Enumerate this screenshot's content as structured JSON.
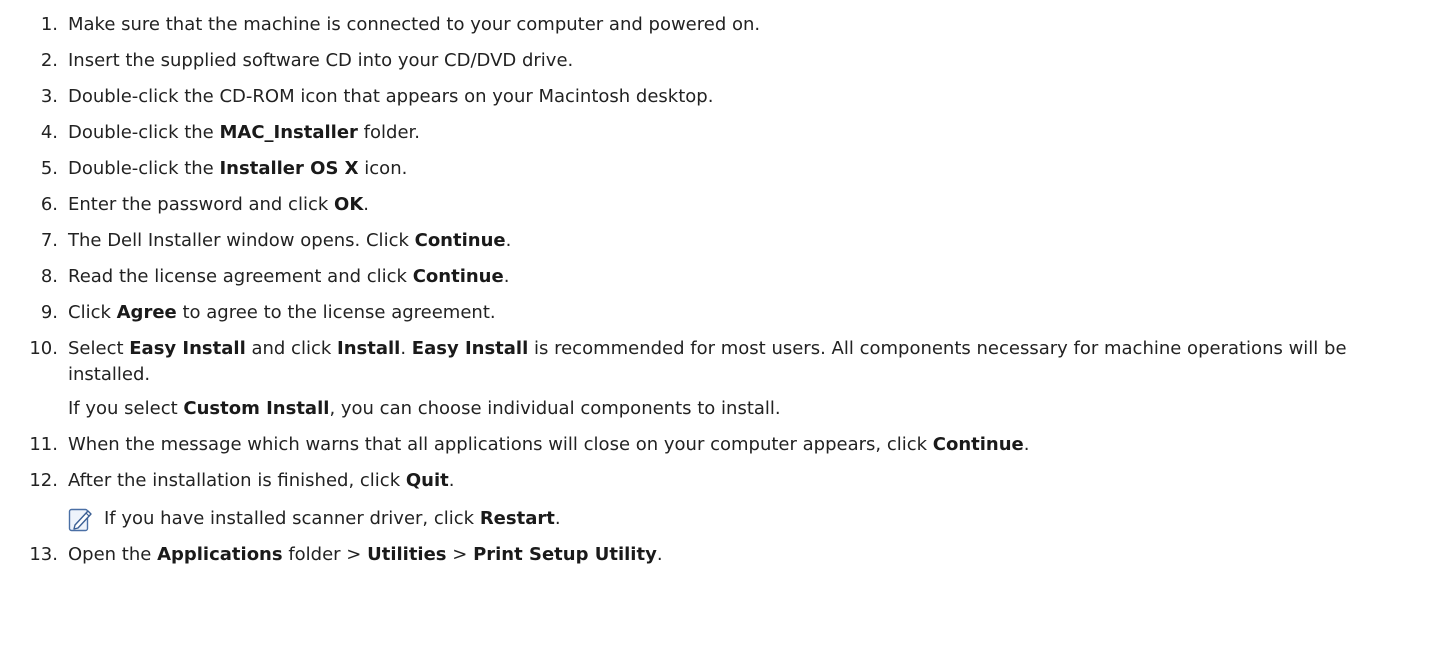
{
  "steps": [
    {
      "num": "1.",
      "parts": [
        "Make sure that the machine is connected to your computer and powered on."
      ]
    },
    {
      "num": "2.",
      "parts": [
        "Insert the supplied software CD into your CD/DVD drive."
      ]
    },
    {
      "num": "3.",
      "parts": [
        "Double-click the CD-ROM icon that appears on your Macintosh desktop."
      ]
    },
    {
      "num": "4.",
      "a": "Double-click the ",
      "b": "MAC_Installer",
      "c": " folder."
    },
    {
      "num": "5.",
      "a": "Double-click the ",
      "b": "Installer OS X",
      "c": " icon."
    },
    {
      "num": "6.",
      "a": "Enter the password and click ",
      "b": "OK",
      "c": "."
    },
    {
      "num": "7.",
      "a": "The Dell Installer window opens. Click ",
      "b": "Continue",
      "c": "."
    },
    {
      "num": "8.",
      "a": "Read the license agreement and click ",
      "b": "Continue",
      "c": "."
    },
    {
      "num": "9.",
      "a": "Click ",
      "b": "Agree",
      "c": " to agree to the license agreement."
    },
    {
      "num": "10.",
      "a": "Select ",
      "b": "Easy Install",
      "c": " and click ",
      "d": "Install",
      "e": ". ",
      "f": "Easy Install",
      "g": " is recommended for most users. All components necessary for machine operations will be installed.",
      "sub_a": "If you select ",
      "sub_b": "Custom Install",
      "sub_c": ", you can choose individual components to install."
    },
    {
      "num": "11.",
      "a": "When the message which warns that all applications will close on your computer appears, click ",
      "b": "Continue",
      "c": "."
    },
    {
      "num": "12.",
      "a": "After the installation is finished, click ",
      "b": "Quit",
      "c": ".",
      "note_a": "If you have installed scanner driver, click ",
      "note_b": "Restart",
      "note_c": "."
    },
    {
      "num": "13.",
      "a": "Open the ",
      "b": "Applications",
      "c": " folder > ",
      "d": "Utilities",
      "e": " > ",
      "f": "Print Setup Utility",
      "g": "."
    }
  ],
  "icons": {
    "note": "note-pencil-icon"
  }
}
